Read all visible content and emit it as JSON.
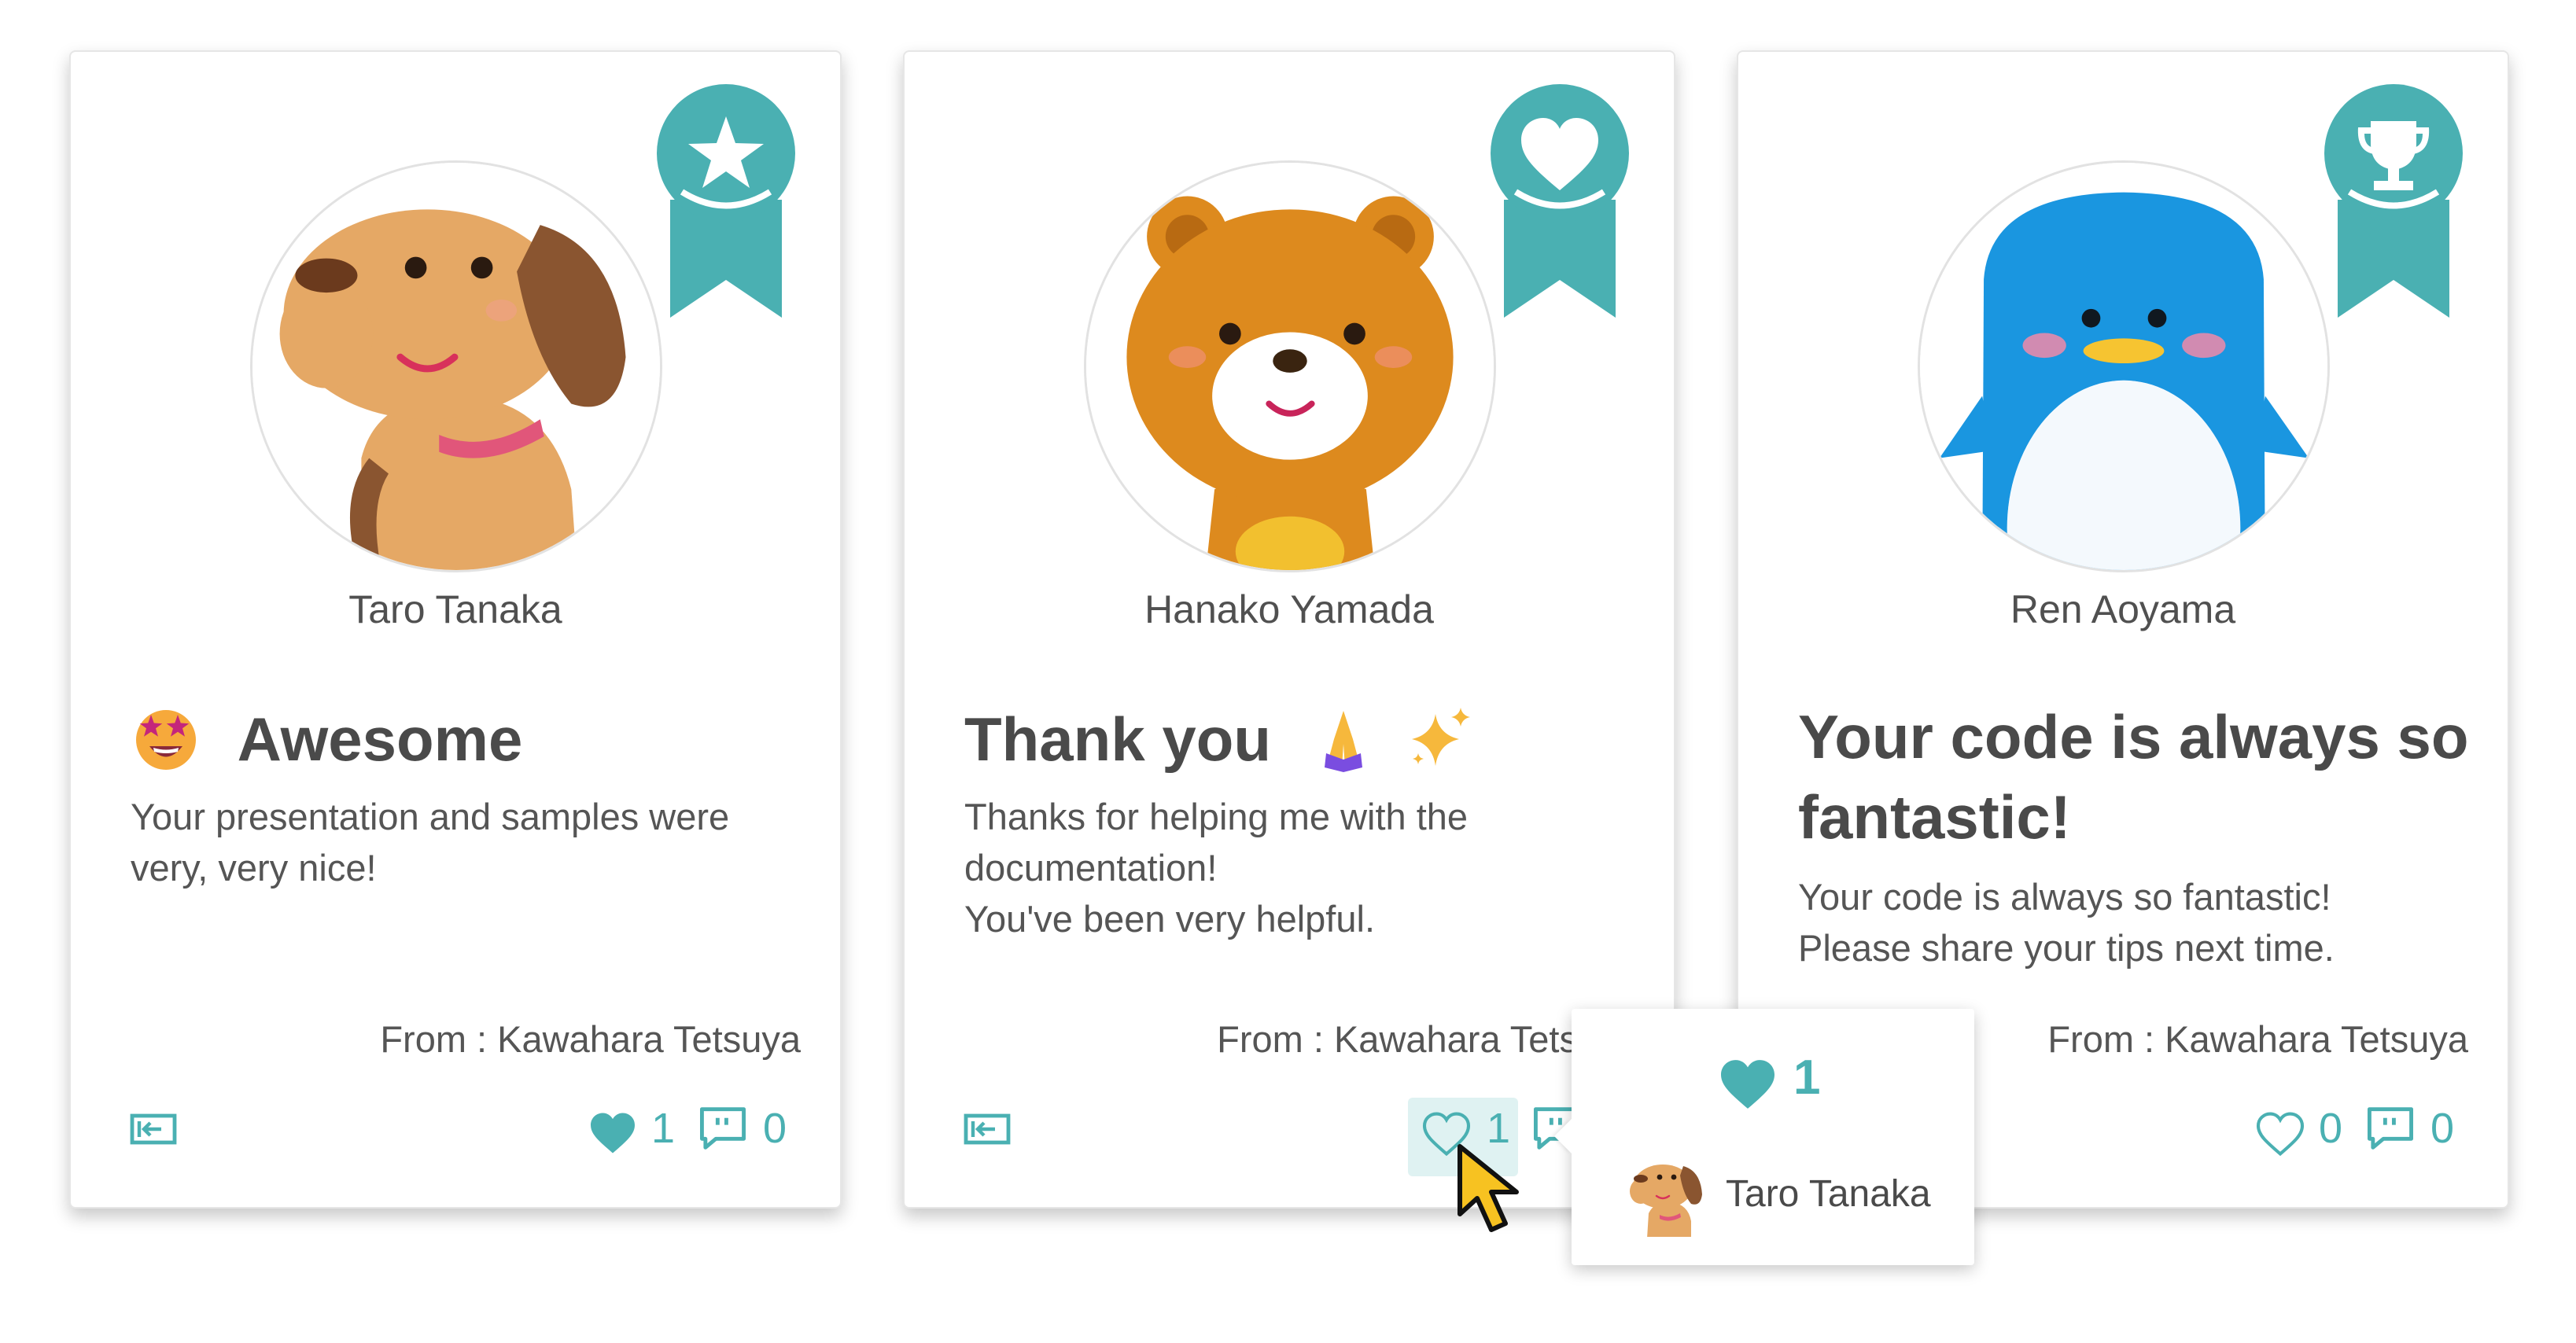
{
  "colors": {
    "accent": "#4ab0b2",
    "text": "#4a4a4a",
    "muted": "#555555",
    "hover_bg": "#dff2f2"
  },
  "cards": [
    {
      "recipient": "Taro Tanaka",
      "badge_icon": "star-icon",
      "avatar": "dog",
      "title": "Awesome",
      "title_emoji": "star-struck-emoji",
      "message": "Your presentation and samples were\nvery, very nice!",
      "from": "From : Kawahara Tetsuya",
      "likes": "1",
      "liked": true,
      "comments": "0"
    },
    {
      "recipient": "Hanako Yamada",
      "badge_icon": "heart-icon",
      "avatar": "bear",
      "title": "Thank you",
      "title_emoji": "folded-hands-sparkles-emoji",
      "message": "Thanks for helping me with the\ndocumentation!\nYou've been very helpful.",
      "from": "From : Kawahara Tets",
      "likes": "1",
      "liked": false,
      "comments": ""
    },
    {
      "recipient": "Ren Aoyama",
      "badge_icon": "trophy-icon",
      "avatar": "penguin",
      "title": "Your code is always so fantastic!",
      "message": "Your code is always so fantastic!\nPlease share your tips next time.",
      "from": "From : Kawahara Tetsuya",
      "likes": "0",
      "liked": false,
      "comments": "0"
    }
  ],
  "like_popup": {
    "count": "1",
    "user": "Taro Tanaka"
  }
}
